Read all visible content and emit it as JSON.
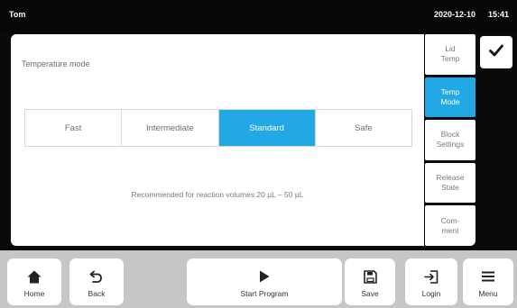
{
  "status_bar": {
    "user": "Tom",
    "date": "2020-12-10",
    "time": "15:41"
  },
  "panel": {
    "title": "Temperature mode",
    "options": [
      "Fast",
      "Intermediate",
      "Standard",
      "Safe"
    ],
    "selected": "Standard",
    "recommendation": "Recommended for reaction volumes 20 µL – 50 µL"
  },
  "side_tabs": [
    {
      "label_line1": "Lid",
      "label_line2": "Temp",
      "active": false
    },
    {
      "label_line1": "Temp",
      "label_line2": "Mode",
      "active": true
    },
    {
      "label_line1": "Block",
      "label_line2": "Settings",
      "active": false
    },
    {
      "label_line1": "Release",
      "label_line2": "State",
      "active": false
    },
    {
      "label_line1": "Com-",
      "label_line2": "ment",
      "active": false
    }
  ],
  "confirm_icon": "checkmark-icon",
  "bottom_bar": {
    "home": "Home",
    "back": "Back",
    "start_program": "Start Program",
    "save": "Save",
    "login": "Login",
    "menu": "Menu"
  },
  "colors": {
    "accent": "#23a8e6",
    "background": "#0a0a0a",
    "bottom_bar": "#c4c7c6"
  }
}
